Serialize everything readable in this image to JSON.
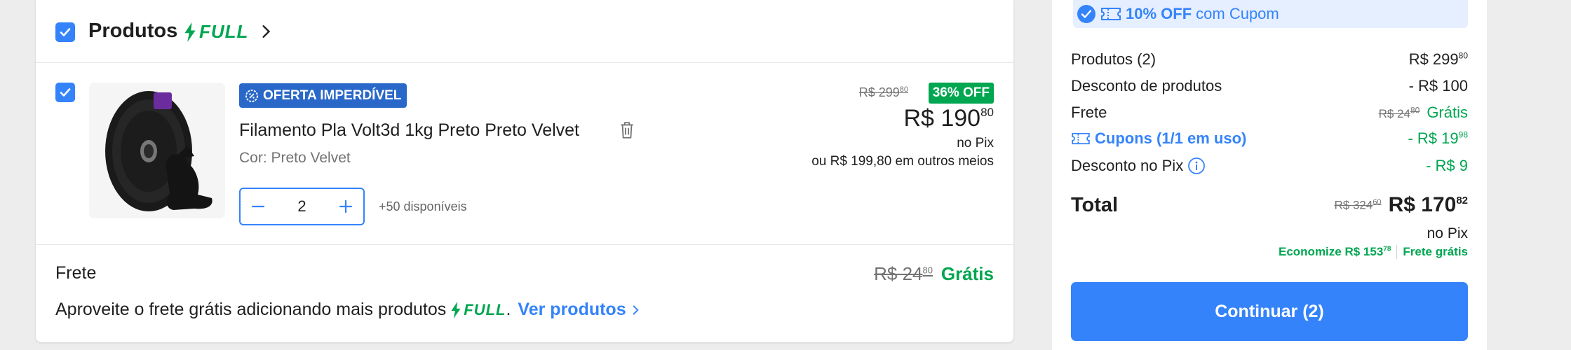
{
  "products_section": {
    "title": "Produtos",
    "badge": "FULL"
  },
  "item": {
    "badge": "OFERTA IMPERDÍVEL",
    "title": "Filamento Pla Volt3d 1kg Preto Preto Velvet",
    "color": "Cor: Preto Velvet",
    "quantity": "2",
    "available": "+50 disponíveis",
    "old_price_int": "R$ 299",
    "old_price_cents": "80",
    "discount_badge": "36% OFF",
    "price_int": "R$ 190",
    "price_cents": "80",
    "pix_label": "no Pix",
    "other_methods": "ou R$ 199,80 em outros meios"
  },
  "shipping": {
    "label": "Frete",
    "old_int": "R$ 24",
    "old_cents": "80",
    "free": "Grátis",
    "promo_text": "Aproveite o frete grátis adicionando mais produtos",
    "promo_badge": "FULL",
    "promo_dot": ".",
    "promo_link": "Ver produtos"
  },
  "summary": {
    "coupon_bar_pct": "10% OFF",
    "coupon_bar_text": "com Cupom",
    "produtos_label": "Produtos (2)",
    "produtos_int": "R$ 299",
    "produtos_cents": "80",
    "desconto_label": "Desconto de produtos",
    "desconto_value": "- R$ 100",
    "frete_label": "Frete",
    "frete_old_int": "R$ 24",
    "frete_old_cents": "80",
    "frete_value": "Grátis",
    "cupons_label": "Cupons (1/1 em uso)",
    "cupons_int": "- R$ 19",
    "cupons_cents": "98",
    "pix_label": "Desconto no Pix",
    "pix_value": "- R$ 9",
    "total_label": "Total",
    "total_old_int": "R$ 324",
    "total_old_cents": "60",
    "total_int": "R$ 170",
    "total_cents": "82",
    "total_pix": "no Pix",
    "economize_int": "Economize R$ 153",
    "economize_cents": "78",
    "frete_gratis": "Frete grátis",
    "continue_button": "Continuar (2)"
  },
  "colors": {
    "accent": "#3483fa",
    "green": "#00a650",
    "oferta_badge": "#2968c8"
  },
  "icons": [
    "check-icon",
    "bolt-icon",
    "chevron-right-icon",
    "percent-seal-icon",
    "trash-icon",
    "minus-icon",
    "plus-icon",
    "ticket-icon",
    "info-icon",
    "check-circle-icon"
  ]
}
